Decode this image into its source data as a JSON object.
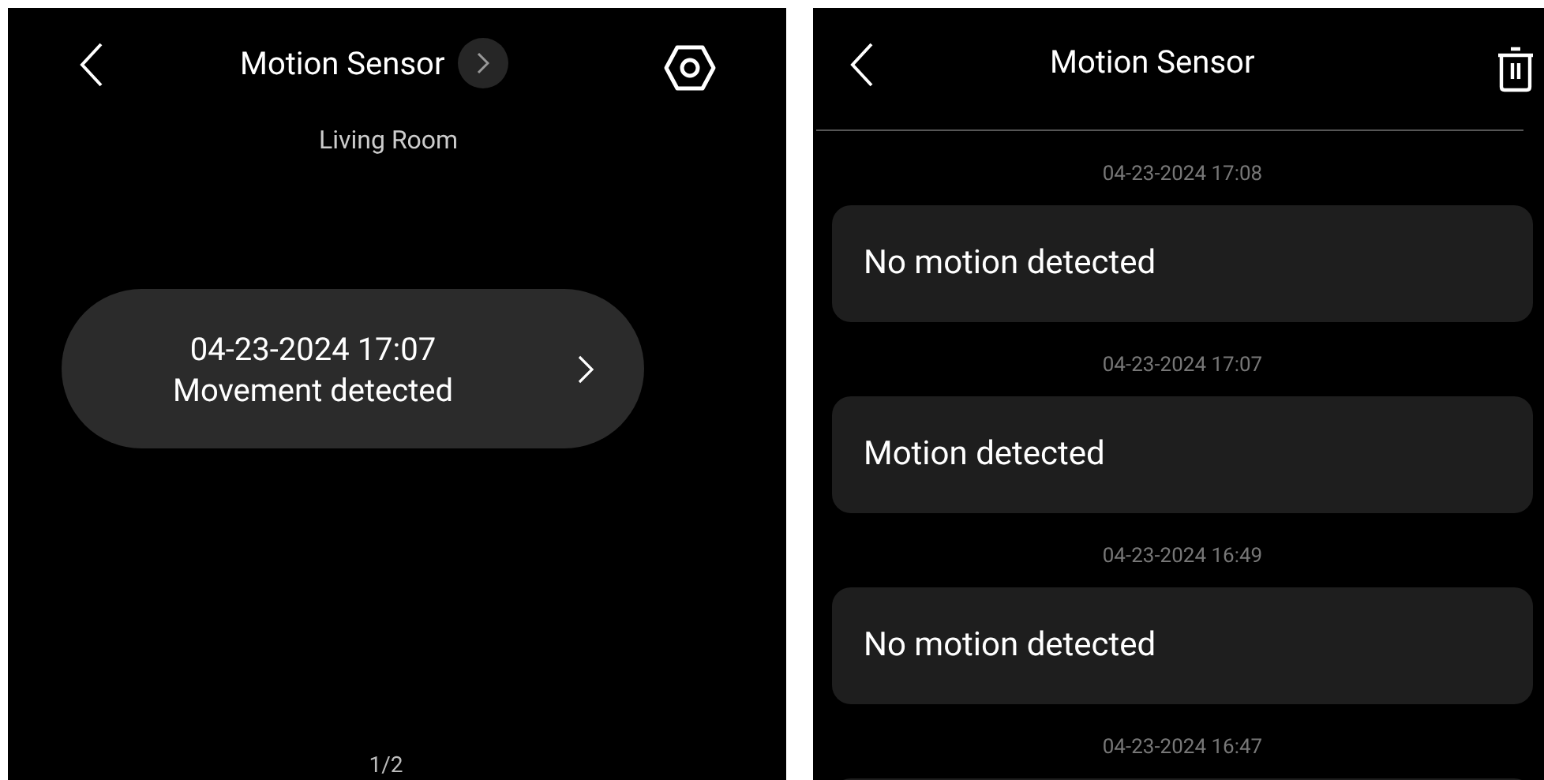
{
  "device_screen": {
    "title": "Motion Sensor",
    "subtitle": "Living Room",
    "latest_event": {
      "time": "04-23-2024 17:07",
      "text": "Movement detected"
    },
    "page_indicator": "1/2"
  },
  "log_screen": {
    "title": "Motion Sensor",
    "events": [
      {
        "time": "04-23-2024 17:08",
        "text": "No motion detected"
      },
      {
        "time": "04-23-2024 17:07",
        "text": "Motion detected"
      },
      {
        "time": "04-23-2024 16:49",
        "text": "No motion detected"
      },
      {
        "time": "04-23-2024 16:47"
      }
    ]
  }
}
